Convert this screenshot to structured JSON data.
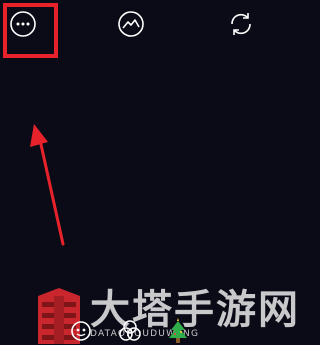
{
  "toolbar": {
    "more_icon": "more-dots-icon",
    "gallery_icon": "gallery-icon",
    "flip_icon": "flip-camera-icon"
  },
  "highlight_color": "#e8222b",
  "arrow_color": "#e8222b",
  "background_color": "#0b0b17",
  "watermark": {
    "title": "大塔手游网",
    "subtitle": "DATAOHOUDUWANG"
  },
  "bottom_bar": {
    "icons": [
      "beauty-face-icon",
      "filter-icon",
      "christmas-tree-icon"
    ]
  }
}
